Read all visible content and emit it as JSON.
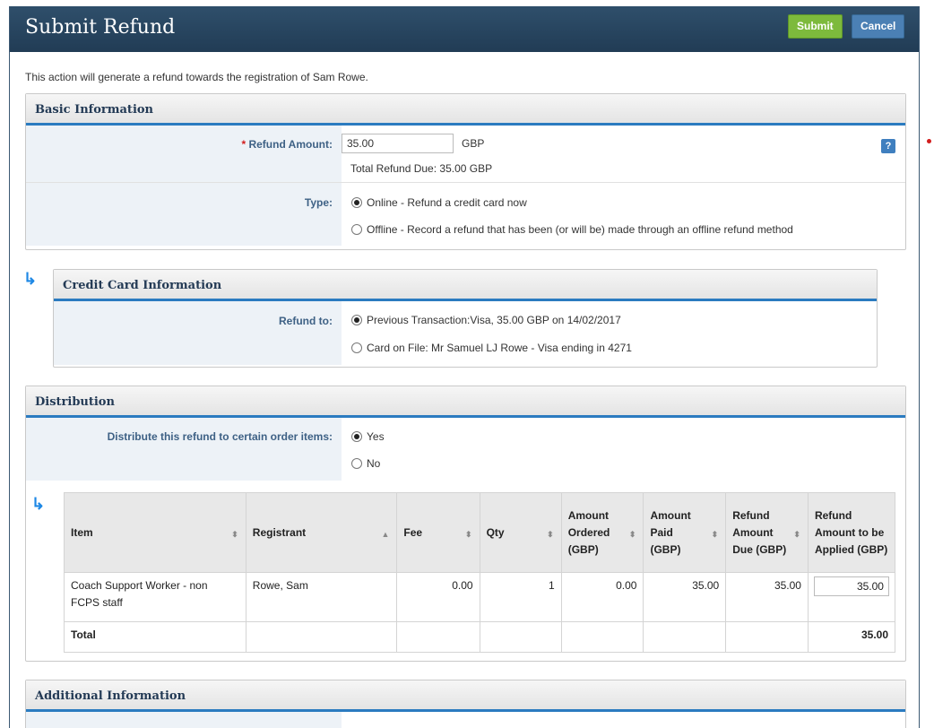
{
  "window": {
    "title": "Submit Refund",
    "submit_label": "Submit",
    "cancel_label": "Cancel"
  },
  "intro_text": "This action will generate a refund towards the registration of Sam Rowe.",
  "basic": {
    "header": "Basic Information",
    "refund_amount_label": "Refund Amount:",
    "refund_amount_value": "35.00",
    "currency": "GBP",
    "total_due": "Total Refund Due: 35.00 GBP",
    "help_label": "?",
    "type_label": "Type:",
    "type_options": [
      {
        "label": "Online - Refund a credit card now",
        "selected": true
      },
      {
        "label": "Offline - Record a refund that has been (or will be) made through an offline refund method",
        "selected": false
      }
    ]
  },
  "credit_card": {
    "header": "Credit Card Information",
    "refund_to_label": "Refund to:",
    "options": [
      {
        "label": "Previous Transaction:Visa, 35.00 GBP on 14/02/2017",
        "selected": true
      },
      {
        "label": "Card on File: Mr Samuel LJ Rowe - Visa ending in 4271",
        "selected": false
      }
    ]
  },
  "distribution": {
    "header": "Distribution",
    "distribute_label": "Distribute this refund to certain order items:",
    "options": [
      {
        "label": "Yes",
        "selected": true
      },
      {
        "label": "No",
        "selected": false
      }
    ],
    "columns": [
      "Item",
      "Registrant",
      "Fee",
      "Qty",
      "Amount Ordered (GBP)",
      "Amount Paid (GBP)",
      "Refund Amount Due (GBP)",
      "Refund Amount to be Applied (GBP)"
    ],
    "rows": [
      {
        "item": "Coach Support Worker - non FCPS staff",
        "registrant": "Rowe, Sam",
        "fee": "0.00",
        "qty": "1",
        "amount_ordered": "0.00",
        "amount_paid": "35.00",
        "refund_due": "35.00",
        "refund_applied": "35.00"
      }
    ],
    "total_label": "Total",
    "total_value": "35.00"
  },
  "additional": {
    "header": "Additional Information"
  },
  "colors": {
    "title_bar": "#2f4f6b",
    "submit": "#7dba3c",
    "cancel": "#4b80b4",
    "accent": "#2b7bc0",
    "label_bg": "#edf2f7"
  }
}
